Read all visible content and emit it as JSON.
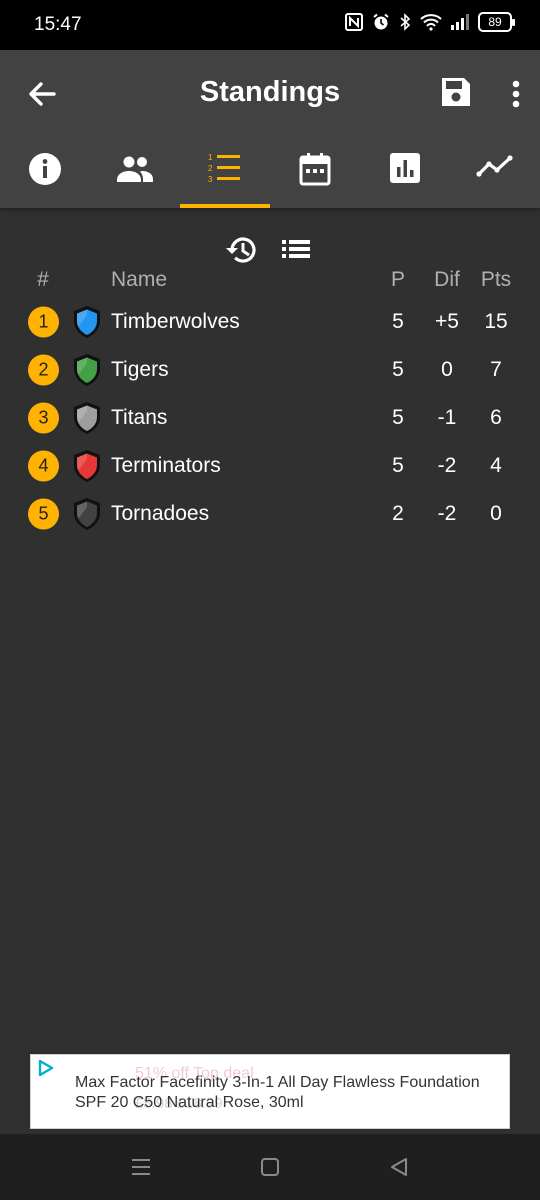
{
  "status_bar": {
    "time": "15:47",
    "battery": "89",
    "icons": [
      "nfc-icon",
      "alarm-icon",
      "bluetooth-icon",
      "wifi-icon",
      "signal-icon",
      "battery-icon"
    ]
  },
  "app_bar": {
    "title": "Standings",
    "back_icon": "arrow-back-icon",
    "save_icon": "save-icon",
    "more_icon": "more-vert-icon"
  },
  "tabs": [
    {
      "name": "info",
      "icon": "info-icon",
      "selected": false
    },
    {
      "name": "teams",
      "icon": "people-icon",
      "selected": false
    },
    {
      "name": "standings",
      "icon": "numbered-list-icon",
      "selected": true
    },
    {
      "name": "schedule",
      "icon": "calendar-icon",
      "selected": false
    },
    {
      "name": "stats",
      "icon": "bar-chart-icon",
      "selected": false
    },
    {
      "name": "trends",
      "icon": "line-trend-icon",
      "selected": false
    }
  ],
  "toolbar": {
    "history_icon": "history-icon",
    "list_icon": "list-icon"
  },
  "table": {
    "headers": {
      "rank": "#",
      "name": "Name",
      "played": "P",
      "diff": "Dif",
      "points": "Pts"
    },
    "rows": [
      {
        "rank": "1",
        "name": "Timberwolves",
        "played": "5",
        "diff": "+5",
        "points": "15",
        "shield_color": "#2196f3"
      },
      {
        "rank": "2",
        "name": "Tigers",
        "played": "5",
        "diff": "0",
        "points": "7",
        "shield_color": "#43a047"
      },
      {
        "rank": "3",
        "name": "Titans",
        "played": "5",
        "diff": "-1",
        "points": "6",
        "shield_color": "#9e9e9e"
      },
      {
        "rank": "4",
        "name": "Terminators",
        "played": "5",
        "diff": "-2",
        "points": "4",
        "shield_color": "#e53935"
      },
      {
        "rank": "5",
        "name": "Tornadoes",
        "played": "2",
        "diff": "-2",
        "points": "0",
        "shield_color": "#424242"
      }
    ]
  },
  "ad": {
    "text": "Max Factor Facefinity 3-In-1 All Day Flawless Foundation SPF 20 C50 Natural Rose, 30ml",
    "ghost_badge": "51% off  Top deal",
    "ghost_price": "£8.98  £18.99"
  },
  "colors": {
    "accent": "#ffb300",
    "background": "#303030",
    "appbar": "#424242"
  }
}
